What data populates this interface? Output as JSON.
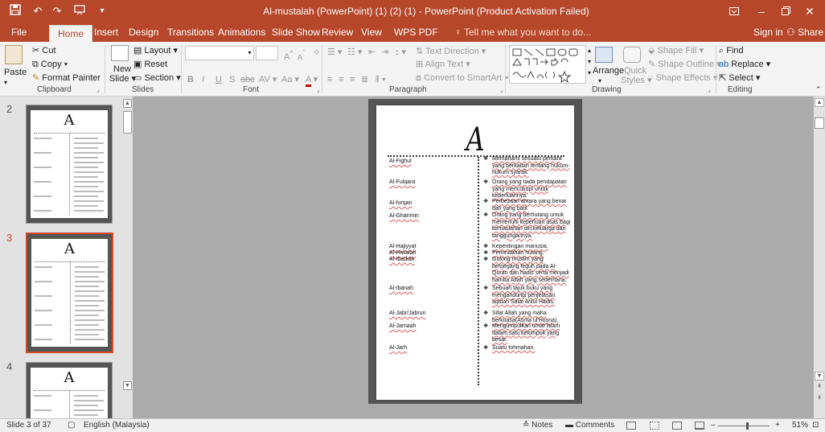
{
  "app": {
    "title": "Al-mustalah (PowerPoint) (1) (2) (1) - PowerPoint (Product Activation Failed)",
    "accent": "#b7472a"
  },
  "quick_access": {
    "save_icon": "save-icon",
    "undo_icon": "undo-icon",
    "redo_icon": "redo-icon",
    "present_icon": "slideshow-from-start-icon",
    "customize_icon": "customize-qat-icon"
  },
  "window": {
    "restore_ribbon": "ribbon-display-icon",
    "minimize": "–",
    "maximize": "restore-icon",
    "close": "✕"
  },
  "tabs": [
    "File",
    "Home",
    "Insert",
    "Design",
    "Transitions",
    "Animations",
    "Slide Show",
    "Review",
    "View",
    "WPS PDF"
  ],
  "active_tab": "Home",
  "tell_me": "Tell me what you want to do...",
  "sign_in": "Sign in",
  "share": "Share",
  "ribbon": {
    "clipboard": {
      "label": "Clipboard",
      "paste": "Paste",
      "cut": "Cut",
      "copy": "Copy",
      "format_painter": "Format Painter"
    },
    "slides": {
      "label": "Slides",
      "new_slide_1": "New",
      "new_slide_2": "Slide",
      "layout": "Layout",
      "reset": "Reset",
      "section": "Section"
    },
    "font": {
      "label": "Font",
      "font_name": "",
      "font_size": "",
      "bold": "B",
      "italic": "I",
      "underline": "U",
      "shadow": "S",
      "strike": "abc",
      "spacing": "AV",
      "case": "Aa",
      "grow": "A",
      "shrink": "A",
      "clear": "A",
      "color": "A"
    },
    "paragraph": {
      "label": "Paragraph",
      "text_direction": "Text Direction",
      "align_text": "Align Text",
      "smartart": "Convert to SmartArt"
    },
    "drawing": {
      "label": "Drawing",
      "arrange": "Arrange",
      "quick_styles_1": "Quick",
      "quick_styles_2": "Styles",
      "shape_fill": "Shape Fill",
      "shape_outline": "Shape Outline",
      "shape_effects": "Shape Effects"
    },
    "editing": {
      "label": "Editing",
      "find": "Find",
      "replace": "Replace",
      "select": "Select"
    }
  },
  "thumbnails": [
    {
      "number": "2",
      "selected": false,
      "letter": "A"
    },
    {
      "number": "3",
      "selected": true,
      "letter": "A"
    },
    {
      "number": "4",
      "selected": false,
      "letter": "A"
    }
  ],
  "slide": {
    "heading": "A",
    "entries": [
      {
        "term": "Al-Fighul",
        "definition": "Memahami sesuatu perkara yang berkaitan tentang hukum-hukum syarak."
      },
      {
        "term": "Al-Fulqara",
        "definition": "Orang yang tiada pendapatan yang mencukupi untuk keperluannya."
      },
      {
        "term": "Al-furqan",
        "definition": "Perbezaan antara yang benar dan yang batil."
      },
      {
        "term": "Al-Gharimin",
        "definition": "Orang yang berhutang untuk memenuhi keperluan asas bagi kemaslahan diri,keluarga dan tanggungannya."
      },
      {
        "term": "Al-Hajiyyat",
        "definition": "Kepentingan manusia."
      },
      {
        "term": "Al-Hiwalah",
        "definition": "Pemindahan hutang."
      },
      {
        "term": "Al-Ibadiah",
        "definition": "Golong muslim yang berpegang teguh pada Al-Quran dan hadis serta menjadi hamba Allah yang sederhana."
      },
      {
        "term": "Al-Ibanah",
        "definition": "Sebuah tajuk buku yang mengandungi penjelasan aqidah Salaf Ahlul Hadis."
      },
      {
        "term": "Al-Jabr/Jabrun",
        "definition": "Sifat Allah yang maha berkuasa(Asma ul'Husna)."
      },
      {
        "term": "Al-Jamaah",
        "definition": "Mengumpulkan umat Islam dalam satu kelompok yang besar."
      },
      {
        "term": "Al-Jarh",
        "definition": "Suatu tohmahan."
      }
    ]
  },
  "status": {
    "slide_of": "Slide 3 of 37",
    "language": "English (Malaysia)",
    "notes": "Notes",
    "comments": "Comments",
    "zoom_out": "–",
    "zoom_in": "+",
    "zoom": "51%"
  }
}
